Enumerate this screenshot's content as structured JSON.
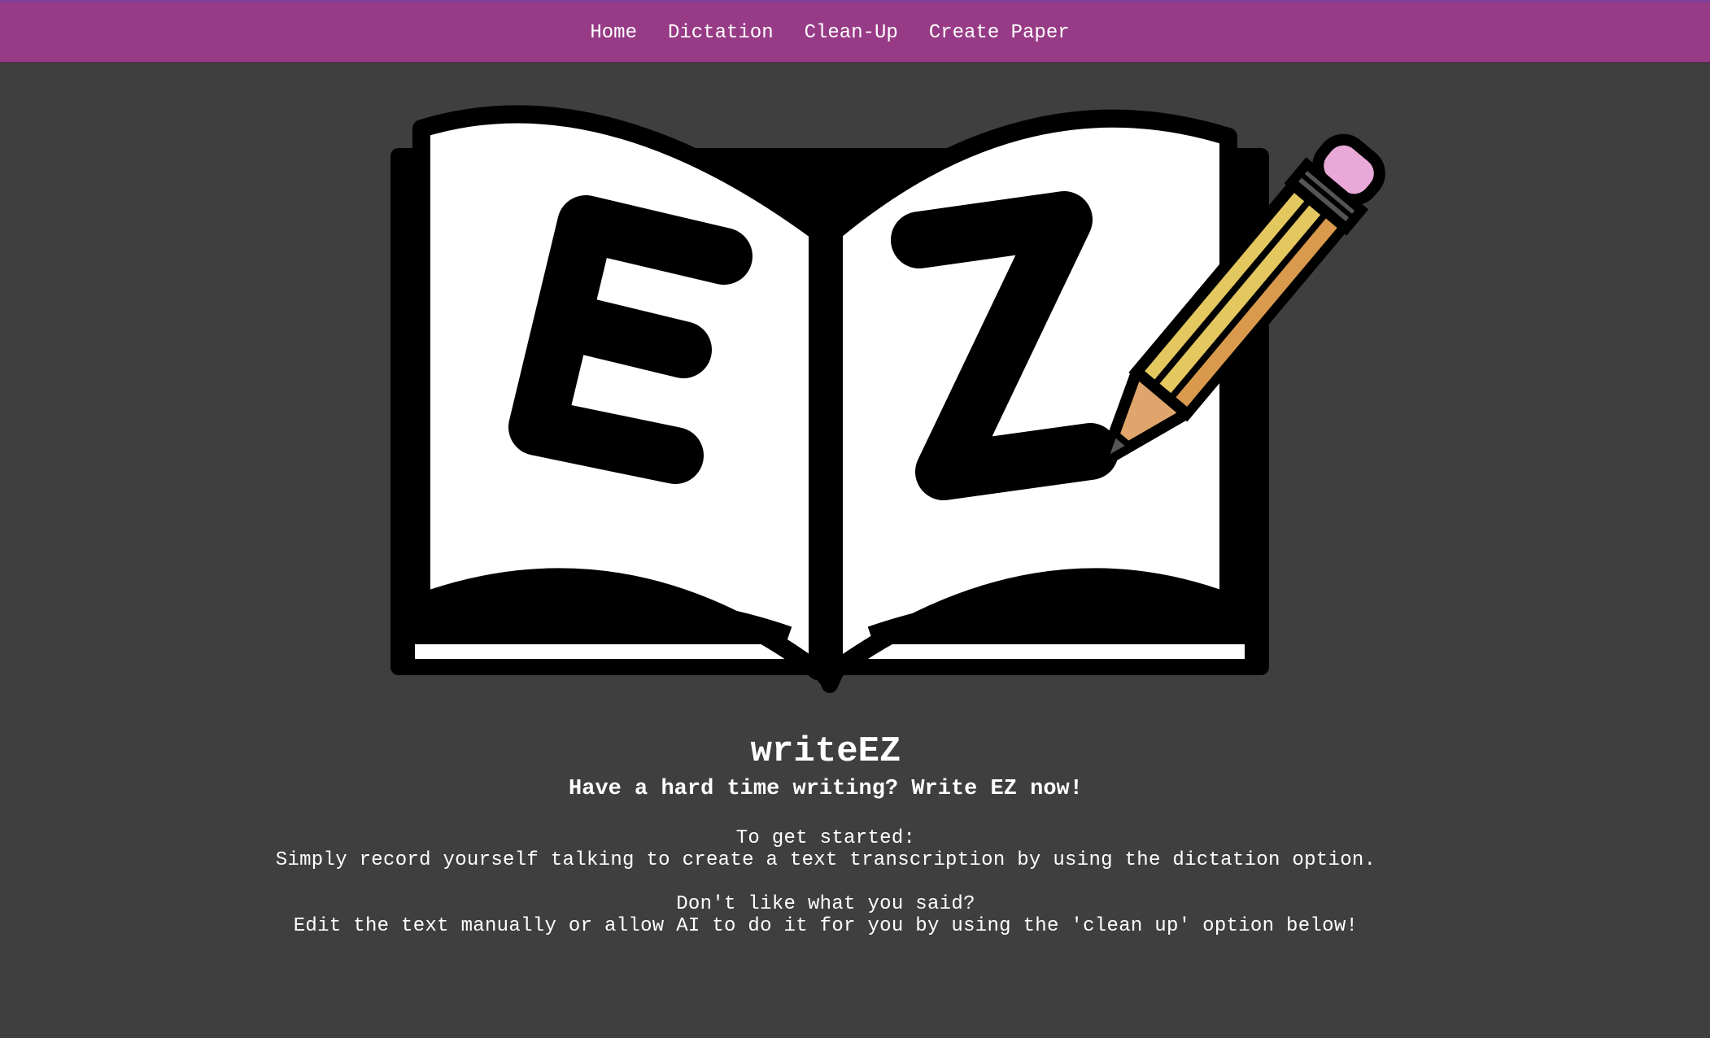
{
  "nav": {
    "items": [
      {
        "label": "Home"
      },
      {
        "label": "Dictation"
      },
      {
        "label": "Clean-Up"
      },
      {
        "label": "Create Paper"
      }
    ]
  },
  "logo": {
    "letters": "EZ",
    "icons": [
      "open-book-icon",
      "pencil-icon"
    ]
  },
  "hero": {
    "title": "writeEZ",
    "tagline": "Have a hard time writing? Write EZ now!",
    "get_started_heading": "To get started:",
    "get_started_text": "Simply record yourself talking to create a text transcription by using the dictation option.",
    "dislike_heading": "Don't like what you said?",
    "dislike_text": "Edit the text manually or allow AI to do it for you by using the 'clean up' option below!"
  },
  "colors": {
    "topbar": "#983b87",
    "background": "#3f3f3f",
    "text": "#ffffff",
    "pencil_body": "#e3c75f",
    "pencil_eraser": "#e9a9d8"
  }
}
